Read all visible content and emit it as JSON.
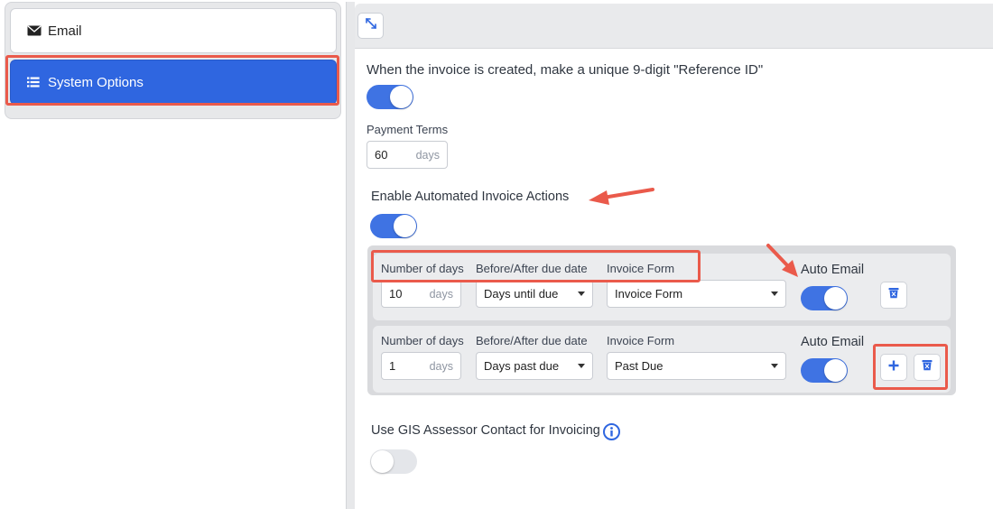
{
  "sidebar": {
    "items": [
      {
        "label": "Email",
        "icon": "envelope-icon"
      },
      {
        "label": "System Options",
        "icon": "list-icon",
        "active": true
      }
    ]
  },
  "main": {
    "reference_id_label": "When the invoice is created, make a unique 9-digit \"Reference ID\"",
    "reference_id_enabled": true,
    "payment_terms": {
      "label": "Payment Terms",
      "value": "60",
      "unit": "days"
    },
    "automated_actions": {
      "label": "Enable Automated Invoice Actions",
      "enabled": true,
      "rows": [
        {
          "days_label": "Number of days",
          "days_value": "10",
          "days_unit": "days",
          "when_label": "Before/After due date",
          "when_value": "Days until due",
          "form_label": "Invoice Form",
          "form_value": "Invoice Form",
          "auto_email_label": "Auto Email",
          "auto_email": true
        },
        {
          "days_label": "Number of days",
          "days_value": "1",
          "days_unit": "days",
          "when_label": "Before/After due date",
          "when_value": "Days past due",
          "form_label": "Invoice Form",
          "form_value": "Past Due",
          "auto_email_label": "Auto Email",
          "auto_email": true
        }
      ]
    },
    "gis_label": "Use GIS Assessor Contact for Invoicing",
    "gis_enabled": false
  },
  "colors": {
    "primary": "#2f66e0",
    "toggle_on": "#3f73e3",
    "annotation": "#ea5a4b"
  }
}
